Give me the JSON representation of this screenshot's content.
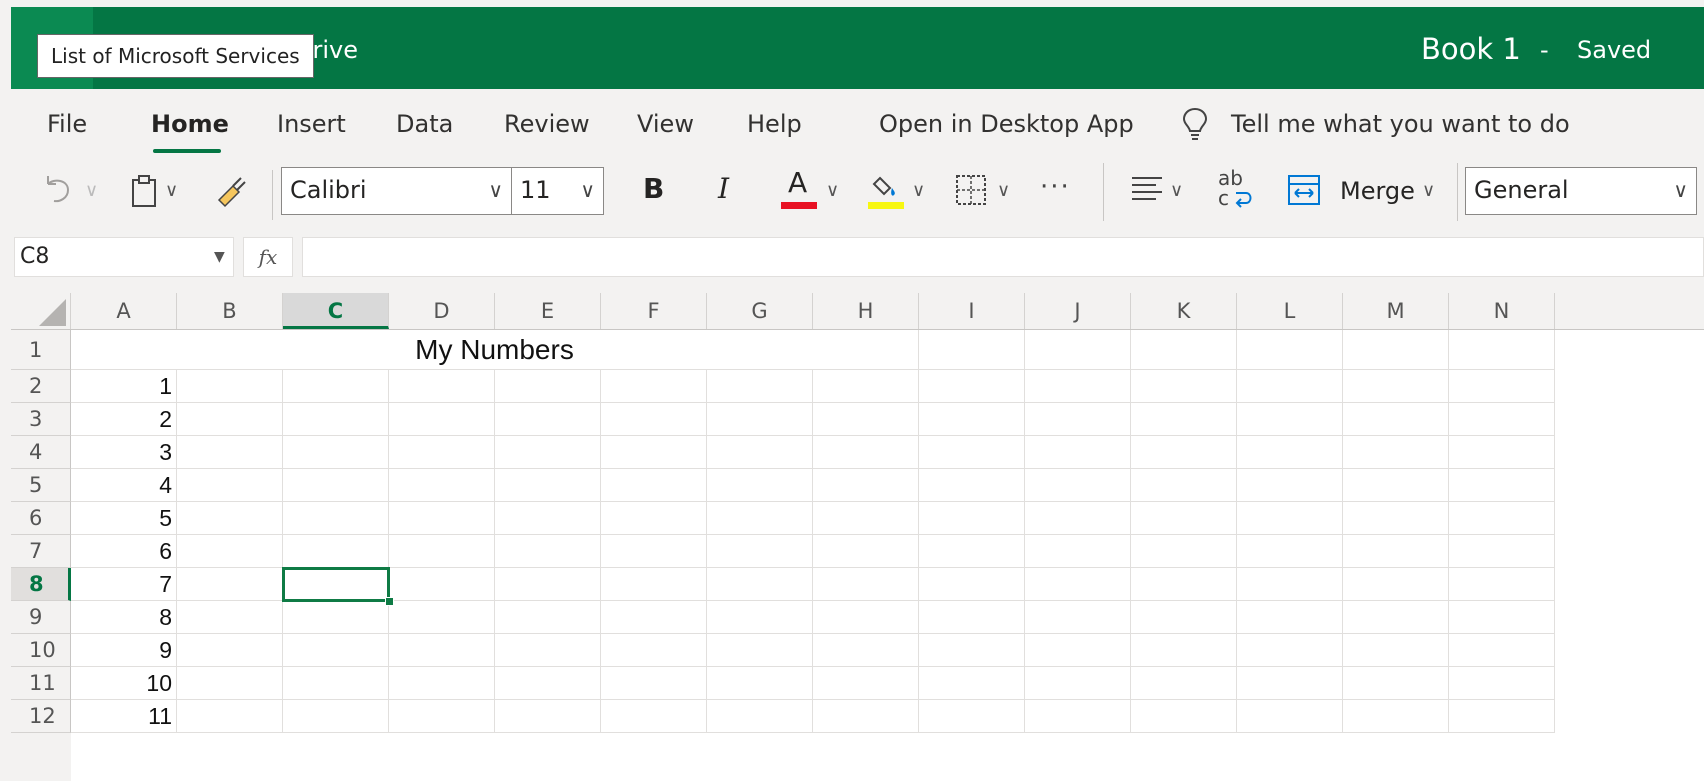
{
  "titlebar": {
    "tooltip": "List of Microsoft Services",
    "app_name": "Drive",
    "book_title": "Book 1",
    "separator": "-",
    "save_status": "Saved",
    "background_color": "#047644"
  },
  "menu": {
    "items": [
      "File",
      "Home",
      "Insert",
      "Data",
      "Review",
      "View",
      "Help",
      "Open in Desktop App"
    ],
    "active": "Home",
    "tell_me": "Tell me what you want to do"
  },
  "toolbar": {
    "undo_icon": "undo-icon",
    "paste_icon": "clipboard-icon",
    "format_painter_icon": "paintbrush-icon",
    "font_name": "Calibri",
    "font_size": "11",
    "bold_label": "B",
    "italic_label": "I",
    "font_color_label": "A",
    "font_color": "#e81123",
    "fill_color": "#f7f711",
    "more_label": "···",
    "wrap_label_top": "ab",
    "wrap_label_bottom": "c",
    "merge_label": "Merge",
    "number_format": "General"
  },
  "formula_bar": {
    "name_box": "C8",
    "fx_label": "fx",
    "formula": ""
  },
  "sheet": {
    "columns": [
      "A",
      "B",
      "C",
      "D",
      "E",
      "F",
      "G",
      "H",
      "I",
      "J",
      "K",
      "L",
      "M",
      "N"
    ],
    "rows": [
      "1",
      "2",
      "3",
      "4",
      "5",
      "6",
      "7",
      "8",
      "9",
      "10",
      "11",
      "12"
    ],
    "selected_column": "C",
    "selected_row": "8",
    "title_cell": "My Numbers",
    "column_a_values": [
      "1",
      "2",
      "3",
      "4",
      "5",
      "6",
      "7",
      "8",
      "9",
      "10",
      "11"
    ]
  }
}
